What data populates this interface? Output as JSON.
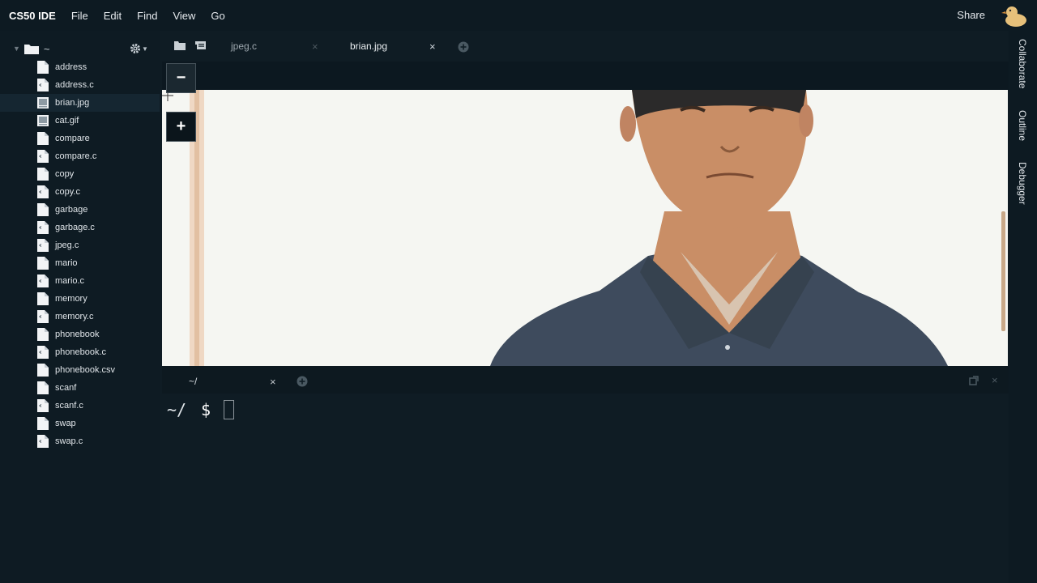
{
  "menubar": {
    "app_title": "CS50 IDE",
    "items": [
      "File",
      "Edit",
      "Find",
      "View",
      "Go"
    ],
    "share_label": "Share"
  },
  "sidebar": {
    "root_label": "~",
    "files": [
      {
        "name": "address",
        "icon": "file-icon"
      },
      {
        "name": "address.c",
        "icon": "c-file-icon"
      },
      {
        "name": "brian.jpg",
        "icon": "image-file-icon",
        "selected": true
      },
      {
        "name": "cat.gif",
        "icon": "image-file-icon"
      },
      {
        "name": "compare",
        "icon": "file-icon"
      },
      {
        "name": "compare.c",
        "icon": "c-file-icon"
      },
      {
        "name": "copy",
        "icon": "file-icon"
      },
      {
        "name": "copy.c",
        "icon": "c-file-icon"
      },
      {
        "name": "garbage",
        "icon": "file-icon"
      },
      {
        "name": "garbage.c",
        "icon": "c-file-icon"
      },
      {
        "name": "jpeg.c",
        "icon": "c-file-icon"
      },
      {
        "name": "mario",
        "icon": "file-icon"
      },
      {
        "name": "mario.c",
        "icon": "c-file-icon"
      },
      {
        "name": "memory",
        "icon": "file-icon"
      },
      {
        "name": "memory.c",
        "icon": "c-file-icon"
      },
      {
        "name": "phonebook",
        "icon": "file-icon"
      },
      {
        "name": "phonebook.c",
        "icon": "c-file-icon"
      },
      {
        "name": "phonebook.csv",
        "icon": "file-icon"
      },
      {
        "name": "scanf",
        "icon": "file-icon"
      },
      {
        "name": "scanf.c",
        "icon": "c-file-icon"
      },
      {
        "name": "swap",
        "icon": "file-icon"
      },
      {
        "name": "swap.c",
        "icon": "c-file-icon"
      }
    ]
  },
  "editor": {
    "tabs": [
      {
        "label": "jpeg.c",
        "close": "×",
        "active": false
      },
      {
        "label": "brian.jpg",
        "close": "×",
        "active": true
      }
    ],
    "zoom_out_label": "−",
    "zoom_in_label": "+"
  },
  "terminal": {
    "tab_label": "~/",
    "tab_close": "×",
    "pane_close": "×",
    "prompt_path": "~/",
    "prompt_symbol": "$"
  },
  "right_panel": {
    "tabs": [
      "Collaborate",
      "Outline",
      "Debugger"
    ]
  },
  "colors": {
    "background": "#0f1c24",
    "image_background": "#f5f6f2",
    "shirt": "#3d4a5c",
    "skin": "#c98e66"
  }
}
